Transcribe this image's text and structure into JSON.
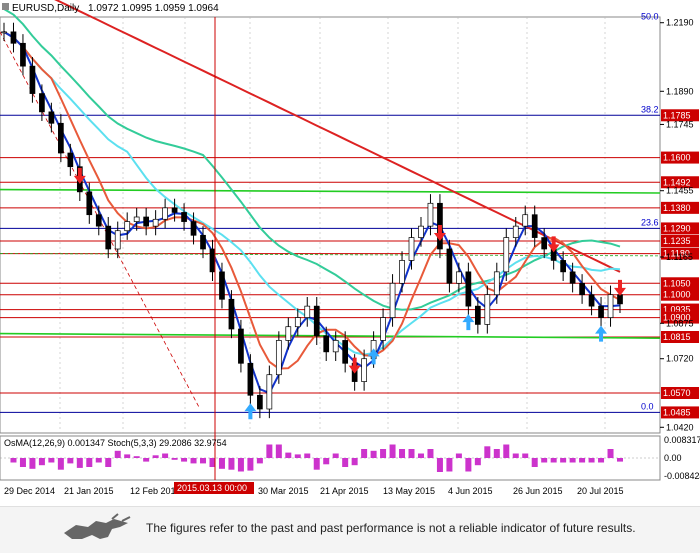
{
  "header": {
    "symbol": "EURUSD,Daily",
    "ohlc": "1.0972 1.0995 1.0959 1.0964"
  },
  "indicator_header": "OsMA(12,26,9) 0.001347  Stoch(5,3,3) 29.2086 32.9754",
  "cursor_date": "2015.03.13 00:00",
  "footer": {
    "disclaimer": "The figures refer to the past and past performance is not a reliable indicator of future results.",
    "logo_icon": "bull-logo-icon"
  },
  "colors": {
    "level_line": "#cc0000",
    "fib_line": "#000099",
    "ma_fast_red": "#e85a3a",
    "ma_cyan": "#5ce0f0",
    "ma_green": "#33cc99",
    "ma_200_red": "#dd2222",
    "trend_green": "#22cc22",
    "trend_blue": "#1133cc",
    "arrow_up": "#33aaff",
    "arrow_down": "#ee2222",
    "osma": "#cc33cc"
  },
  "chart_data": {
    "type": "candlestick",
    "title": "EURUSD,Daily",
    "x_tick_labels": [
      "29 Dec 2014",
      "21 Jan 2015",
      "12 Feb 2015",
      "30 Mar 2015",
      "21 Apr 2015",
      "13 May 2015",
      "4 Jun 2015",
      "26 Jun 2015",
      "20 Jul 2015"
    ],
    "y_tick_labels": [
      "1.2190",
      "1.1890",
      "1.1745",
      "1.1455",
      "1.1165",
      "1.0875",
      "1.0720",
      "1.0420"
    ],
    "ylim": [
      1.0395,
      1.2215
    ],
    "levels": [
      {
        "label": "1.1785",
        "kind": "fib",
        "value": 1.1785
      },
      {
        "label": "1.1600",
        "kind": "level",
        "value": 1.16
      },
      {
        "label": "1.1492",
        "kind": "level",
        "value": 1.1492
      },
      {
        "label": "1.1380",
        "kind": "level",
        "value": 1.138
      },
      {
        "label": "1.1290",
        "kind": "fib",
        "value": 1.129
      },
      {
        "label": "1.1235",
        "kind": "level",
        "value": 1.1235
      },
      {
        "label": "1.1180",
        "kind": "level",
        "value": 1.118
      },
      {
        "label": "1.1050",
        "kind": "level",
        "value": 1.105
      },
      {
        "label": "1.1000",
        "kind": "level",
        "value": 1.1
      },
      {
        "label": "1.0935",
        "kind": "level",
        "value": 1.0935
      },
      {
        "label": "1.0900",
        "kind": "level",
        "value": 1.09
      },
      {
        "label": "1.0815",
        "kind": "level",
        "value": 1.0815
      },
      {
        "label": "1.0570",
        "kind": "level",
        "value": 1.057
      },
      {
        "label": "1.0485",
        "kind": "fib",
        "value": 1.0485
      }
    ],
    "fib_labels": [
      {
        "label": "50.0",
        "value": 1.219
      },
      {
        "label": "38.2",
        "value": 1.1785
      },
      {
        "label": "23.6",
        "value": 1.129
      },
      {
        "label": "0.0",
        "value": 1.0485
      }
    ],
    "price_series": [
      1.215,
      1.21,
      1.2,
      1.188,
      1.18,
      1.175,
      1.162,
      1.156,
      1.145,
      1.135,
      1.13,
      1.12,
      1.128,
      1.132,
      1.134,
      1.13,
      1.133,
      1.138,
      1.136,
      1.132,
      1.126,
      1.12,
      1.11,
      1.098,
      1.085,
      1.07,
      1.056,
      1.05,
      1.065,
      1.08,
      1.086,
      1.09,
      1.095,
      1.082,
      1.075,
      1.08,
      1.07,
      1.062,
      1.072,
      1.08,
      1.09,
      1.105,
      1.115,
      1.125,
      1.13,
      1.14,
      1.12,
      1.105,
      1.11,
      1.095,
      1.087,
      1.1,
      1.11,
      1.125,
      1.13,
      1.135,
      1.125,
      1.12,
      1.115,
      1.11,
      1.105,
      1.1,
      1.095,
      1.09,
      1.1,
      1.096
    ],
    "osma_axis": {
      "top": "0.008317",
      "zero": "0.00",
      "bottom": "-0.008424",
      "stoch_upper": "80",
      "stoch_lower": "20"
    }
  }
}
